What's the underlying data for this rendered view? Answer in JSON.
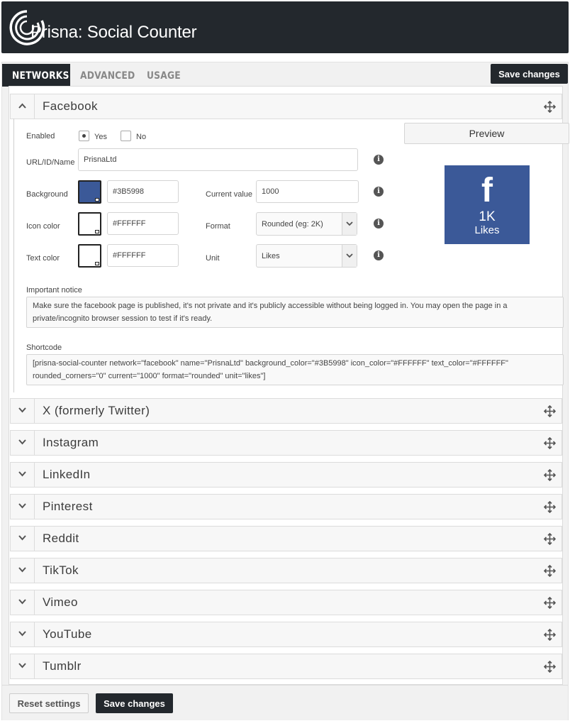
{
  "app": {
    "title": "Prisna: Social Counter"
  },
  "tabs": [
    "NETWORKS",
    "ADVANCED",
    "USAGE"
  ],
  "buttons": {
    "save": "Save changes",
    "reset": "Reset settings"
  },
  "facebook": {
    "name": "Facebook",
    "enabled_label": "Enabled",
    "enabled_options": [
      "Yes",
      "No"
    ],
    "enabled_value": "Yes",
    "url_label": "URL/ID/Name",
    "url_value": "PrisnaLtd",
    "background_label": "Background",
    "background_value": "#3B5998",
    "icon_color_label": "Icon color",
    "icon_color_value": "#FFFFFF",
    "text_color_label": "Text color",
    "text_color_value": "#FFFFFF",
    "current_value_label": "Current value",
    "current_value": "1000",
    "format_label": "Format",
    "format_value": "Rounded (eg: 2K)",
    "unit_label": "Unit",
    "unit_value": "Likes",
    "preview_label": "Preview",
    "preview_count": "1K",
    "preview_unit": "Likes",
    "preview_icon": "facebook-f-icon",
    "notice_label": "Important notice",
    "notice_text": "Make sure the facebook page is published, it's not private and it's publicly accessible without being logged in. You may open the page in a private/incognito browser session to test if it's ready.",
    "shortcode_label": "Shortcode",
    "shortcode_text": "[prisna-social-counter network=\"facebook\" name=\"PrisnaLtd\" background_color=\"#3B5998\" icon_color=\"#FFFFFF\" text_color=\"#FFFFFF\" rounded_corners=\"0\" current=\"1000\" format=\"rounded\" unit=\"likes\"]"
  },
  "networks": [
    "X (formerly Twitter)",
    "Instagram",
    "LinkedIn",
    "Pinterest",
    "Reddit",
    "TikTok",
    "Vimeo",
    "YouTube",
    "Tumblr"
  ],
  "colors": {
    "header_bg": "#23282d",
    "facebook_blue": "#3B5998"
  }
}
